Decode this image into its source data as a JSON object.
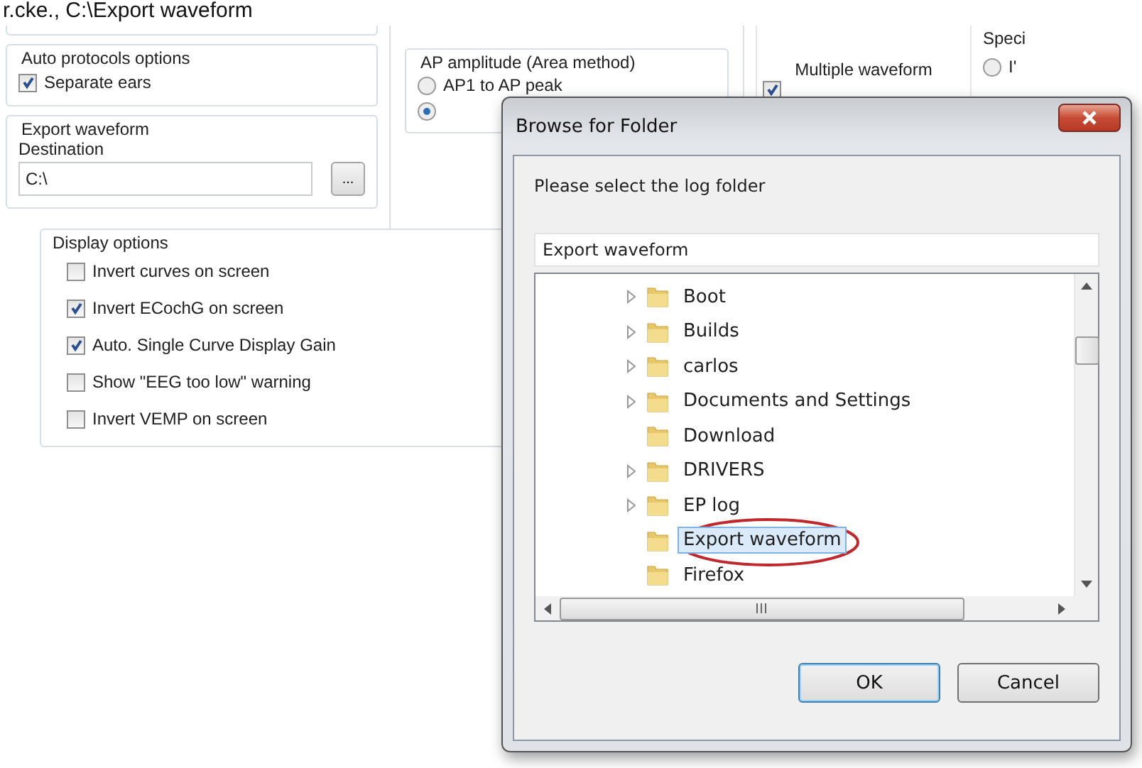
{
  "caption": "r.cke., C:\\Export waveform",
  "auto_protocols": {
    "title": "Auto protocols options",
    "options": [
      {
        "label": "Separate ears",
        "checked": true
      }
    ]
  },
  "export_waveform": {
    "title": "Export waveform",
    "destination_label": "Destination",
    "destination_value": "C:\\",
    "browse_button": "..."
  },
  "display_options": {
    "title": "Display options",
    "options": [
      {
        "label": "Invert curves on screen",
        "checked": false
      },
      {
        "label": "Invert ECochG on screen",
        "checked": true
      },
      {
        "label": "Auto. Single Curve Display Gain",
        "checked": true
      },
      {
        "label": "Show \"EEG too low\" warning",
        "checked": false
      },
      {
        "label": "Invert VEMP on screen",
        "checked": false
      }
    ]
  },
  "ap_amplitude": {
    "title": "AP amplitude (Area method)",
    "options": [
      {
        "label": "AP1 to AP peak",
        "selected": false
      },
      {
        "selected": true
      }
    ]
  },
  "multiple_waveform": {
    "label": "Multiple waveform",
    "checked": true
  },
  "special": {
    "title": "Speci",
    "options": [
      {
        "label": "I'",
        "selected": false
      }
    ]
  },
  "dialog": {
    "title": "Browse for Folder",
    "prompt": "Please select the log folder",
    "folder_field": "Export waveform",
    "tree": [
      {
        "label": "Boot",
        "expandable": true,
        "selected": false
      },
      {
        "label": "Builds",
        "expandable": true,
        "selected": false
      },
      {
        "label": "carlos",
        "expandable": true,
        "selected": false
      },
      {
        "label": "Documents and Settings",
        "expandable": true,
        "selected": false
      },
      {
        "label": "Download",
        "expandable": false,
        "selected": false
      },
      {
        "label": "DRIVERS",
        "expandable": true,
        "selected": false
      },
      {
        "label": "EP log",
        "expandable": true,
        "selected": false
      },
      {
        "label": "Export waveform",
        "expandable": false,
        "selected": true
      },
      {
        "label": "Firefox",
        "expandable": false,
        "selected": false
      }
    ],
    "buttons": [
      {
        "label": "OK",
        "kind": "default"
      },
      {
        "label": "Cancel",
        "kind": "normal"
      }
    ]
  }
}
